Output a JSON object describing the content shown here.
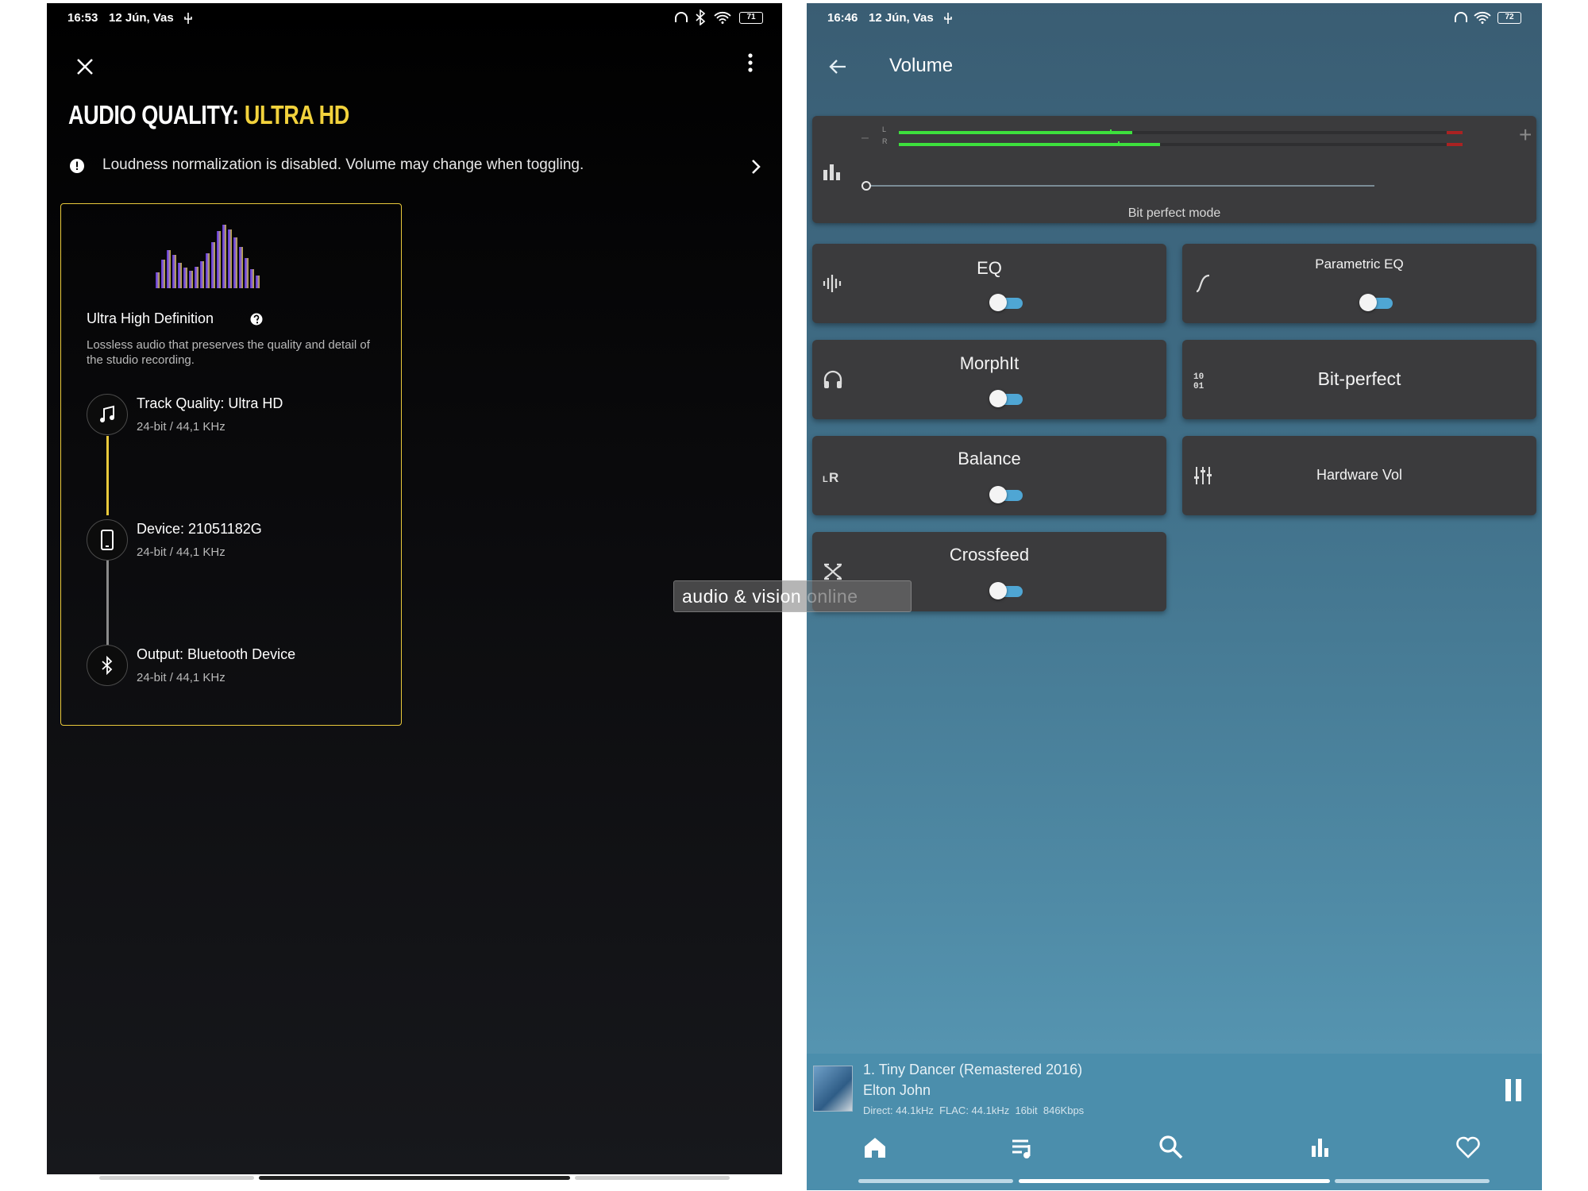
{
  "left": {
    "status": {
      "time": "16:53",
      "date": "12 Jún, Vas",
      "battery": "71"
    },
    "title_prefix": "AUDIO QUALITY:",
    "title_value": "ULTRA HD",
    "notice": "Loudness normalization is disabled. Volume may change when toggling.",
    "card": {
      "heading": "Ultra High Definition",
      "description": "Lossless audio that preserves the quality and detail of the studio recording.",
      "steps": [
        {
          "title": "Track Quality: Ultra HD",
          "sub": "24-bit / 44,1 KHz",
          "icon": "music-note-icon"
        },
        {
          "title": "Device: 21051182G",
          "sub": "24-bit / 44,1 KHz",
          "icon": "phone-icon"
        },
        {
          "title": "Output: Bluetooth Device",
          "sub": "24-bit / 44,1 KHz",
          "icon": "bluetooth-icon"
        }
      ]
    },
    "colors": {
      "accent": "#f2d23c"
    }
  },
  "watermark": {
    "main": "audio & vision",
    "faded": "online"
  },
  "right": {
    "status": {
      "time": "16:46",
      "date": "12 Jún, Vas",
      "battery": "72"
    },
    "title": "Volume",
    "meter": {
      "left_label": "L",
      "right_label": "R",
      "minus": "–",
      "plus": "+",
      "left_level": 0.42,
      "right_level": 0.47,
      "mode_label": "Bit perfect mode"
    },
    "tiles": [
      {
        "label": "EQ",
        "toggle": false,
        "icon": "waveform-icon"
      },
      {
        "label": "Parametric EQ",
        "toggle": false,
        "icon": "curve-icon"
      },
      {
        "label": "MorphIt",
        "toggle": false,
        "icon": "headphones-icon"
      },
      {
        "label": "Bit-perfect",
        "icon": "binary-icon"
      },
      {
        "label": "Balance",
        "toggle": false,
        "icon": "lr-icon"
      },
      {
        "label": "Hardware Vol",
        "icon": "sliders-icon"
      },
      {
        "label": "Crossfeed",
        "toggle": false,
        "icon": "crossfeed-icon"
      }
    ],
    "now_playing": {
      "track": "1. Tiny Dancer (Remastered 2016)",
      "artist": "Elton John",
      "info": "Direct: 44.1kHz  FLAC: 44.1kHz  16bit  846Kbps"
    },
    "nav": [
      "home-icon",
      "queue-icon",
      "search-icon",
      "equalizer-icon",
      "heart-icon"
    ]
  }
}
